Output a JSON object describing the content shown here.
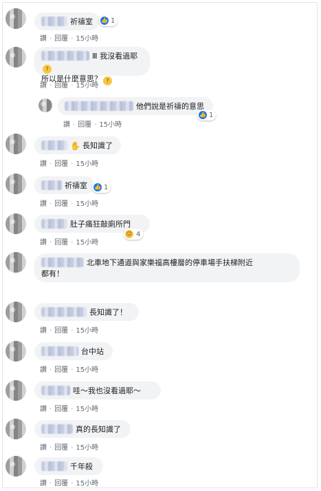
{
  "actions": {
    "like": "讚",
    "reply": "回覆",
    "time": "15小時"
  },
  "comments": [
    {
      "text": "祈禱室",
      "reaction_count": "1"
    },
    {
      "line1": "Ⅲ 我沒看過耶",
      "line2": "所以是什麼意思？"
    },
    {
      "text": "他們說是祈禱的意思",
      "reaction_count": "1"
    },
    {
      "text": "長知識了"
    },
    {
      "text": "祈禱室",
      "reaction_count": "1"
    },
    {
      "text": "肚子痛狂敲廁所門",
      "reaction_count": "4"
    },
    {
      "line1": "北車地下通道與家樂福高樓層的停車場手扶梯附近",
      "line2": "都有！"
    },
    {
      "text": "長知識了！"
    },
    {
      "text": "台中站"
    },
    {
      "text": "哇～我也沒看過耶～"
    },
    {
      "text": "真的長知識了"
    },
    {
      "text": "千年殺"
    }
  ],
  "icons": {
    "like": "thumbs-up-icon",
    "haha": "haha-emoji-icon",
    "thinking": "thinking-emoji-icon",
    "wave": "waving-hand-icon"
  }
}
